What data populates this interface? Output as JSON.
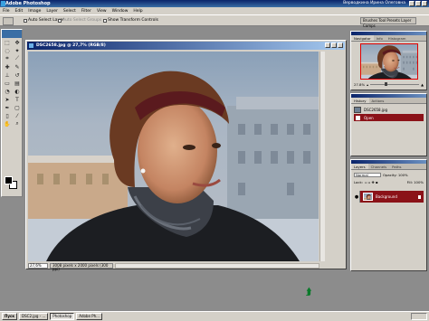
{
  "app": {
    "title": "Adobe Photoshop",
    "user": "Верводкина Ирина Олеговна"
  },
  "menu": [
    "File",
    "Edit",
    "Image",
    "Layer",
    "Select",
    "Filter",
    "View",
    "Window",
    "Help"
  ],
  "options": {
    "auto_select_layer": "Auto Select Layer",
    "auto_select_groups": "Auto Select Groups",
    "show_transform_controls": "Show Transform Controls",
    "brushes_tab": "Brushes  Tool Presets  Layer Comps"
  },
  "document": {
    "title": "DSC2658.jpg @ 27,7% (RGB/8)",
    "zoom": "27,6%",
    "info": "3008 pixels x 2000 pixels (300 ppi)"
  },
  "navigator": {
    "tabs": [
      "Navigator",
      "Info",
      "Histogram"
    ],
    "zoom": "27.8%"
  },
  "history": {
    "tabs": [
      "History",
      "Actions"
    ],
    "snapshot": "DSC2658.jpg",
    "step": "Open"
  },
  "layers": {
    "tabs": [
      "Layers",
      "Channels",
      "Paths"
    ],
    "blend_mode": "Normal",
    "opacity": "Opacity: 100%",
    "lock": "Lock:",
    "fill": "Fill: 100%",
    "layer_name": "Background"
  },
  "taskbar": {
    "start": "Пуск",
    "items": [
      "DSC2.jpg - ...",
      "Photoshop",
      "Adobe Ph..."
    ]
  },
  "colors": {
    "title_bar": "#0a246a",
    "selection": "#8b1218",
    "workspace": "#8c8c8c"
  }
}
